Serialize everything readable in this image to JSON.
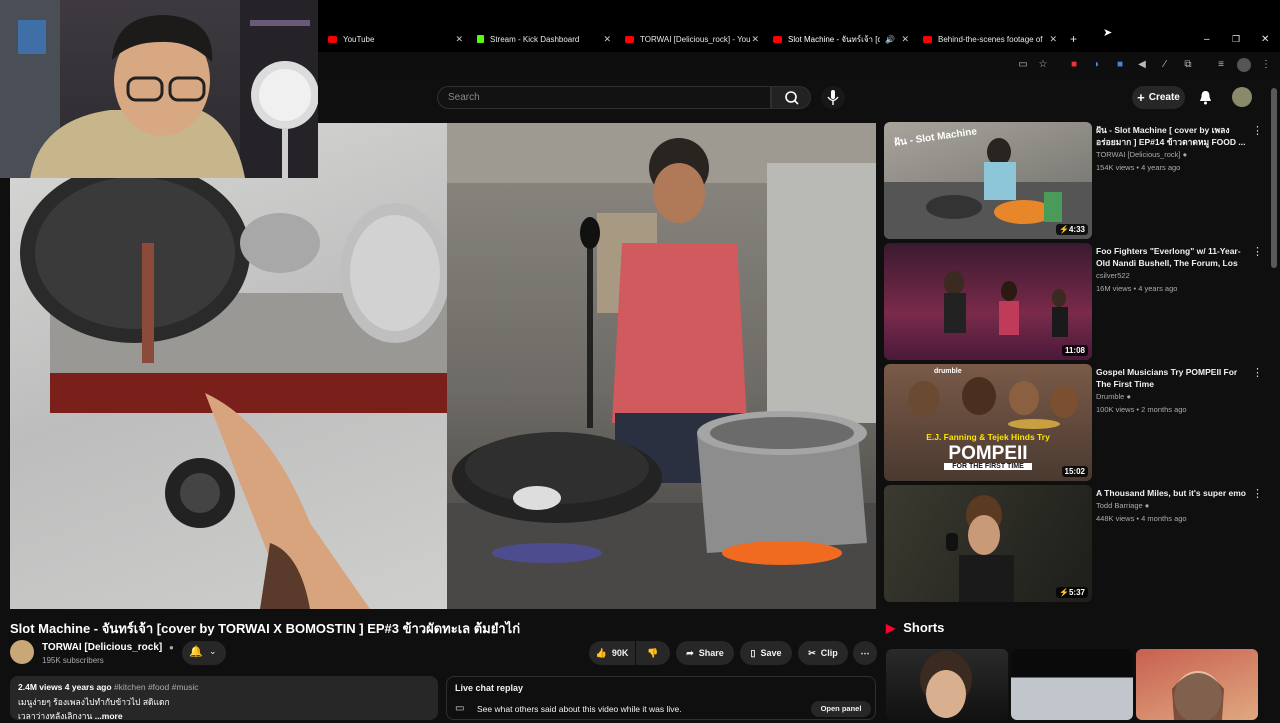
{
  "tabs": [
    {
      "label": "YouTube",
      "icon": "youtube-icon"
    },
    {
      "label": "Stream - Kick Dashboard",
      "icon": "kick-icon"
    },
    {
      "label": "TORWAI [Delicious_rock] - YouT",
      "icon": "youtube-icon"
    },
    {
      "label": "Slot Machine - จันทร์เจ้า [cov",
      "icon": "youtube-icon",
      "active": true
    },
    {
      "label": "Behind-the-scenes footage of t",
      "icon": "youtube-icon"
    }
  ],
  "header": {
    "search_placeholder": "Search",
    "create_label": "Create"
  },
  "video": {
    "title": "Slot Machine - จันทร์เจ้า [cover by TORWAI X BOMOSTIN ] EP#3 ข้าวผัดทะเล ต้มยำไก่",
    "channel": "TORWAI [Delicious_rock]",
    "subscribers": "195K subscribers",
    "likes": "90K",
    "share_label": "Share",
    "save_label": "Save",
    "clip_label": "Clip",
    "views_date": "2.4M views  4 years ago",
    "tags": "#kitchen #food #music",
    "desc_line1": "เมนูง่ายๆ ร้องเพลงไปทำกับข้าวไป สดิแดก",
    "desc_line2": "เวลาว่างหลังเลิกงาน",
    "more_label": "...more"
  },
  "chat": {
    "title": "Live chat replay",
    "text": "See what others said about this video while it was live.",
    "button": "Open panel"
  },
  "recommendations": [
    {
      "title": "ฝัน - Slot Machine [ cover by เพลง อร่อยมาก ] EP#14 ข้าวตาดหมู FOOD ...",
      "channel": "TORWAI [Delicious_rock]",
      "meta": "154K views • 4 years ago",
      "duration": "4:33",
      "verified": true
    },
    {
      "title": "Foo Fighters \"Everlong\" w/ 11-Year-Old Nandi Bushell, The Forum, Los ...",
      "channel": "csilver522",
      "meta": "16M views • 4 years ago",
      "duration": "11:08",
      "verified": false
    },
    {
      "title": "Gospel Musicians Try POMPEII For The First Time",
      "channel": "Drumble",
      "meta": "100K views • 2 months ago",
      "duration": "15:02",
      "verified": true,
      "thumb_text1": "E.J. Fanning & Tejek Hinds Try",
      "thumb_text2": "POMPEII",
      "thumb_text3": "FOR THE FIRST TIME",
      "thumb_brand": "drumble"
    },
    {
      "title": "A Thousand Miles, but it's super emo",
      "channel": "Todd Barriage",
      "meta": "448K views • 4 months ago",
      "duration": "5:37",
      "verified": true
    }
  ],
  "shorts_label": "Shorts",
  "thumb1_text": "ฝัน - Slot Machine",
  "colors": {
    "youtube_red": "#ff0000",
    "kick_green": "#53fc18",
    "bg": "#0f0f0f"
  }
}
